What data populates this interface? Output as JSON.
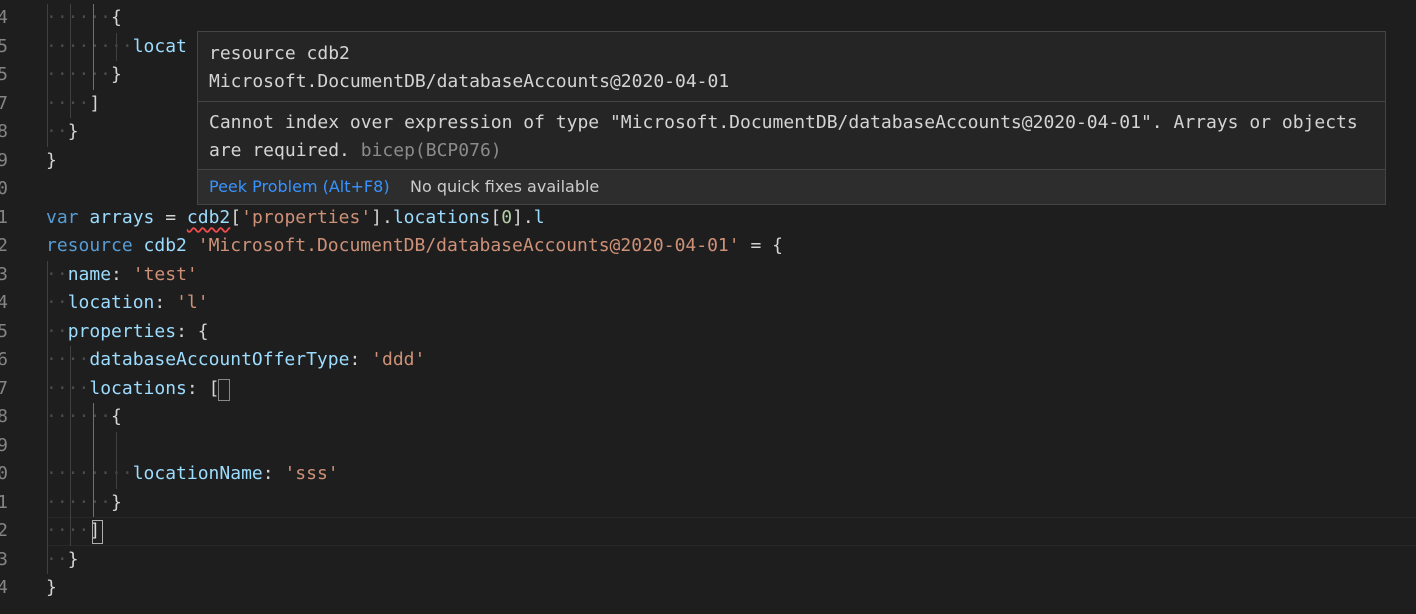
{
  "editor": {
    "lines": [
      {
        "num": "4",
        "indent": "······",
        "tokens": [
          {
            "t": "{",
            "c": "punc"
          }
        ]
      },
      {
        "num": "5",
        "indent": "········",
        "tokens": [
          {
            "t": "locat",
            "c": "var"
          }
        ]
      },
      {
        "num": "5",
        "indent": "······",
        "tokens": [
          {
            "t": "}",
            "c": "punc"
          }
        ]
      },
      {
        "num": "7",
        "indent": "····",
        "tokens": [
          {
            "t": "]",
            "c": "punc"
          }
        ]
      },
      {
        "num": "8",
        "indent": "··",
        "tokens": [
          {
            "t": "}",
            "c": "punc"
          }
        ]
      },
      {
        "num": "9",
        "indent": "",
        "tokens": [
          {
            "t": "}",
            "c": "punc"
          }
        ]
      },
      {
        "num": "0",
        "indent": "",
        "tokens": []
      },
      {
        "num": "1",
        "indent": "",
        "tokens": [
          {
            "t": "var",
            "c": "kw"
          },
          {
            "t": " ",
            "c": "ws"
          },
          {
            "t": "arrays",
            "c": "var"
          },
          {
            "t": " = ",
            "c": "punc"
          },
          {
            "t": "cdb2",
            "c": "var squig"
          },
          {
            "t": "[",
            "c": "punc"
          },
          {
            "t": "'properties'",
            "c": "str"
          },
          {
            "t": "].",
            "c": "punc"
          },
          {
            "t": "locations",
            "c": "var"
          },
          {
            "t": "[",
            "c": "punc"
          },
          {
            "t": "0",
            "c": "num"
          },
          {
            "t": "].",
            "c": "punc"
          },
          {
            "t": "l",
            "c": "var"
          }
        ]
      },
      {
        "num": "2",
        "indent": "",
        "tokens": [
          {
            "t": "resource",
            "c": "kw"
          },
          {
            "t": " ",
            "c": "ws"
          },
          {
            "t": "cdb2",
            "c": "var"
          },
          {
            "t": " ",
            "c": "ws"
          },
          {
            "t": "'Microsoft.DocumentDB/databaseAccounts@2020-04-01'",
            "c": "str"
          },
          {
            "t": " = {",
            "c": "punc"
          }
        ]
      },
      {
        "num": "3",
        "indent": "··",
        "tokens": [
          {
            "t": "name",
            "c": "var"
          },
          {
            "t": ": ",
            "c": "punc"
          },
          {
            "t": "'test'",
            "c": "str"
          }
        ]
      },
      {
        "num": "4",
        "indent": "··",
        "tokens": [
          {
            "t": "location",
            "c": "var"
          },
          {
            "t": ": ",
            "c": "punc"
          },
          {
            "t": "'l'",
            "c": "str"
          }
        ]
      },
      {
        "num": "5",
        "indent": "··",
        "tokens": [
          {
            "t": "properties",
            "c": "var"
          },
          {
            "t": ": {",
            "c": "punc"
          }
        ]
      },
      {
        "num": "6",
        "indent": "····",
        "tokens": [
          {
            "t": "databaseAccountOfferType",
            "c": "var"
          },
          {
            "t": ": ",
            "c": "punc"
          },
          {
            "t": "'ddd'",
            "c": "str"
          }
        ]
      },
      {
        "num": "7",
        "indent": "····",
        "tokens": [
          {
            "t": "locations",
            "c": "var"
          },
          {
            "t": ": [",
            "c": "punc"
          }
        ]
      },
      {
        "num": "8",
        "indent": "······",
        "tokens": [
          {
            "t": "{",
            "c": "punc"
          }
        ]
      },
      {
        "num": "9",
        "indent": "",
        "tokens": []
      },
      {
        "num": "0",
        "indent": "········",
        "tokens": [
          {
            "t": "locationName",
            "c": "var"
          },
          {
            "t": ": ",
            "c": "punc"
          },
          {
            "t": "'sss'",
            "c": "str"
          }
        ]
      },
      {
        "num": "1",
        "indent": "······",
        "tokens": [
          {
            "t": "}",
            "c": "punc"
          }
        ]
      },
      {
        "num": "2",
        "indent": "····",
        "tokens": [
          {
            "t": "]",
            "c": "punc"
          }
        ]
      },
      {
        "num": "3",
        "indent": "··",
        "tokens": [
          {
            "t": "}",
            "c": "punc"
          }
        ]
      },
      {
        "num": "4",
        "indent": "",
        "tokens": [
          {
            "t": "}",
            "c": "punc"
          }
        ]
      }
    ]
  },
  "hover": {
    "signature_line1": "resource cdb2",
    "signature_line2": "Microsoft.DocumentDB/databaseAccounts@2020-04-01",
    "message": "Cannot index over expression of type \"Microsoft.DocumentDB/databaseAccounts@2020-04-01\". Arrays or objects are required.",
    "source": "bicep(BCP076)",
    "peek_label": "Peek Problem (Alt+F8)",
    "no_fixes_label": "No quick fixes available"
  },
  "colors": {
    "background": "#1e1e1e",
    "keyword": "#569cd6",
    "variable": "#9cdcfe",
    "string": "#ce9178",
    "number": "#b5cea8",
    "error_squiggle": "#f14c4c",
    "link": "#3794ff"
  }
}
